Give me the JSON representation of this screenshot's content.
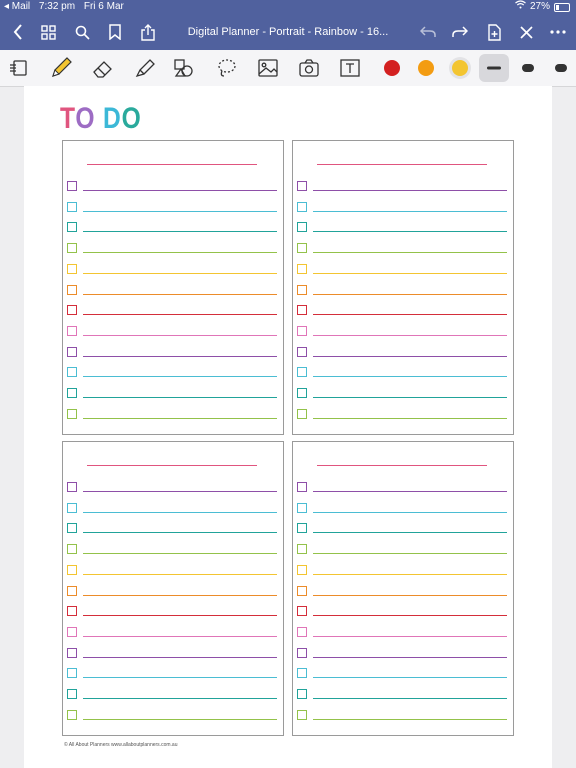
{
  "status_bar": {
    "back_app": "◂ Mail",
    "time": "7:32 pm",
    "date": "Fri 6 Mar",
    "battery": "27%"
  },
  "nav": {
    "title": "Digital Planner - Portrait - Rainbow - 16..."
  },
  "toolbar": {
    "tools": [
      "page-settings-icon",
      "pen-icon",
      "eraser-icon",
      "highlighter-icon",
      "shapes-icon",
      "lasso-icon",
      "image-icon",
      "camera-icon",
      "text-icon"
    ],
    "selected_tool": "pen-icon",
    "color_swatches": [
      "#d32020",
      "#f39c12",
      "#f3c531"
    ],
    "selected_color": "#f3c531",
    "stroke_sizes": [
      "thin",
      "medium",
      "thick"
    ],
    "selected_stroke": "thin"
  },
  "page": {
    "title_to": "TO",
    "title_do": "DO",
    "title_colors": {
      "T": "#e0557f",
      "O1": "#9d6cc4",
      "D": "#3cb8d7",
      "O2": "#2aaa9c"
    },
    "row_colors": [
      "#8e4fa8",
      "#4bbdd3",
      "#21a39a",
      "#93c24a",
      "#f3c531",
      "#ec8c2a",
      "#d42e3a",
      "#e075b8",
      "#8e4fa8",
      "#4bbdd3",
      "#21a39a",
      "#93c24a"
    ],
    "header_line_color": "#e0557f",
    "cards": [
      {
        "id": "card-top-left"
      },
      {
        "id": "card-top-right"
      },
      {
        "id": "card-bottom-left"
      },
      {
        "id": "card-bottom-right"
      }
    ],
    "footer": "© All About Planners  www.allaboutplanners.com.au"
  }
}
